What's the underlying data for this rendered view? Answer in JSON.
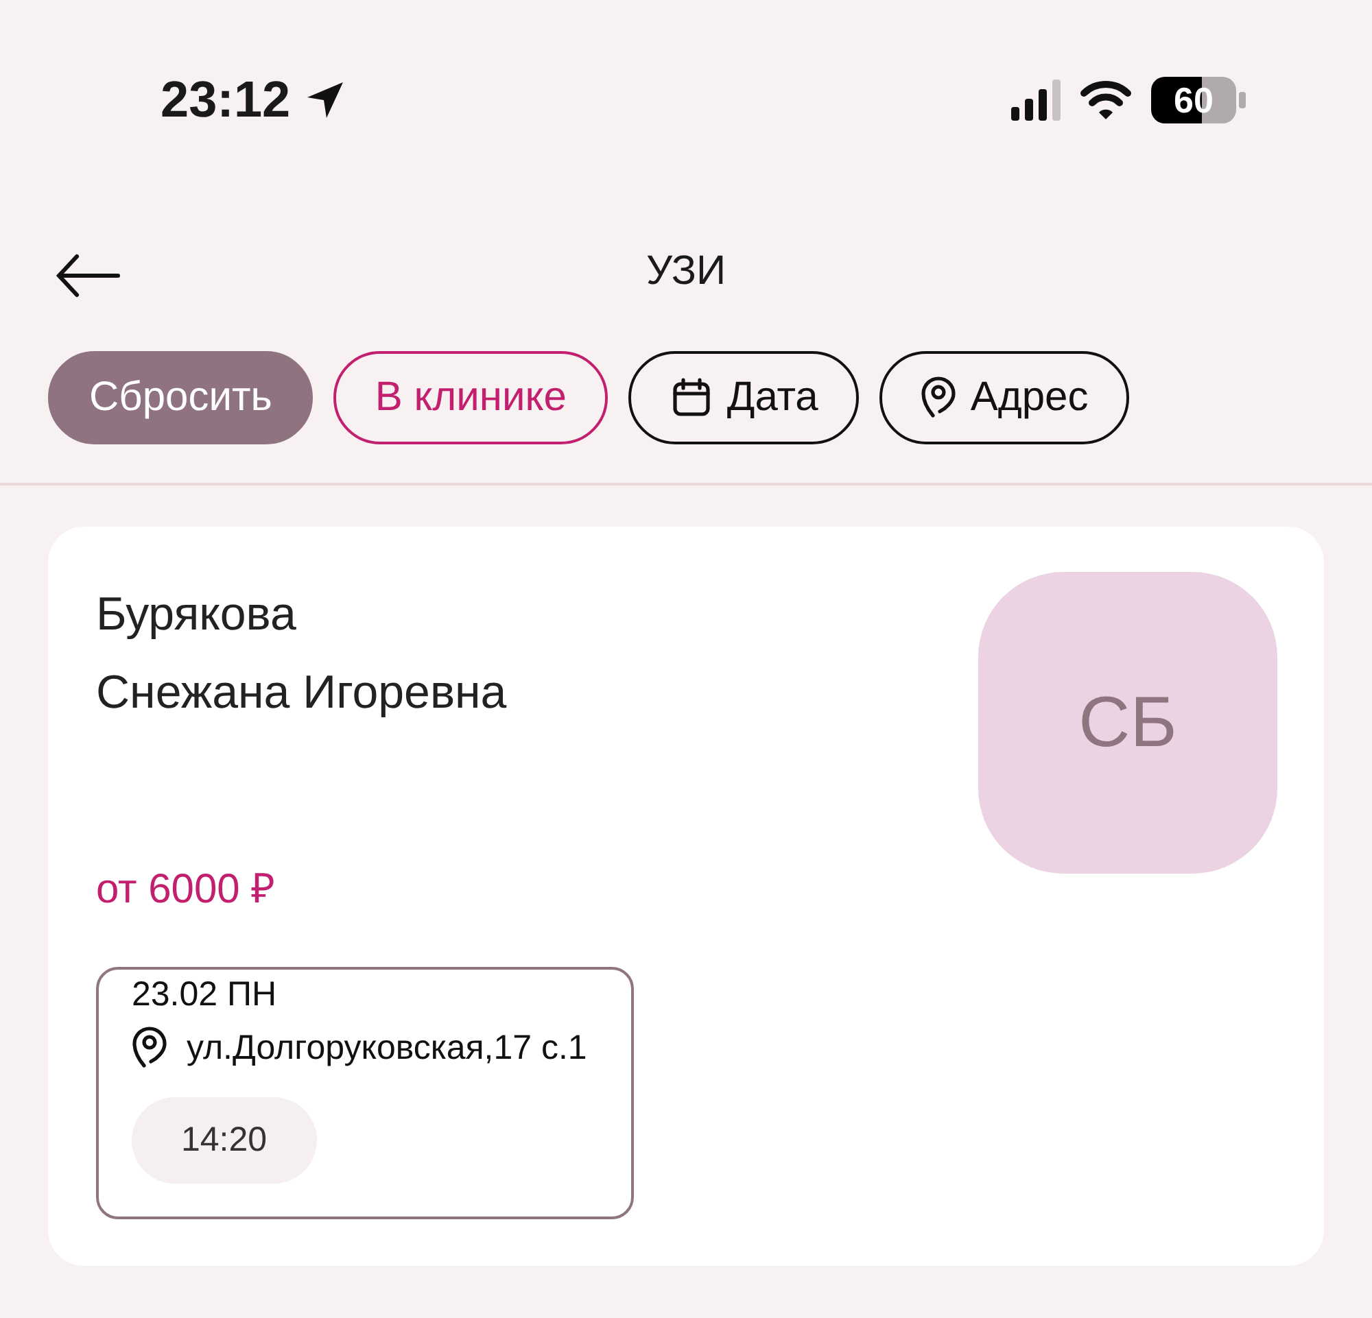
{
  "status_bar": {
    "time": "23:12",
    "battery": "60"
  },
  "header": {
    "title": "УЗИ"
  },
  "filters": [
    {
      "kind": "reset",
      "label": "Сбросить",
      "selected": false
    },
    {
      "kind": "toggle",
      "label": "В клинике",
      "selected": true
    },
    {
      "kind": "date",
      "label": "Дата",
      "selected": false
    },
    {
      "kind": "address",
      "label": "Адрес",
      "selected": false
    }
  ],
  "doctor": {
    "surname": "Бурякова",
    "given_names": "Снежана Игоревна",
    "price": "от 6000 ₽",
    "initials": "СБ",
    "slots": [
      {
        "date": "23.02 ПН",
        "address": "ул.Долгоруковская,17 с.1",
        "times": [
          "14:20"
        ]
      }
    ]
  }
}
